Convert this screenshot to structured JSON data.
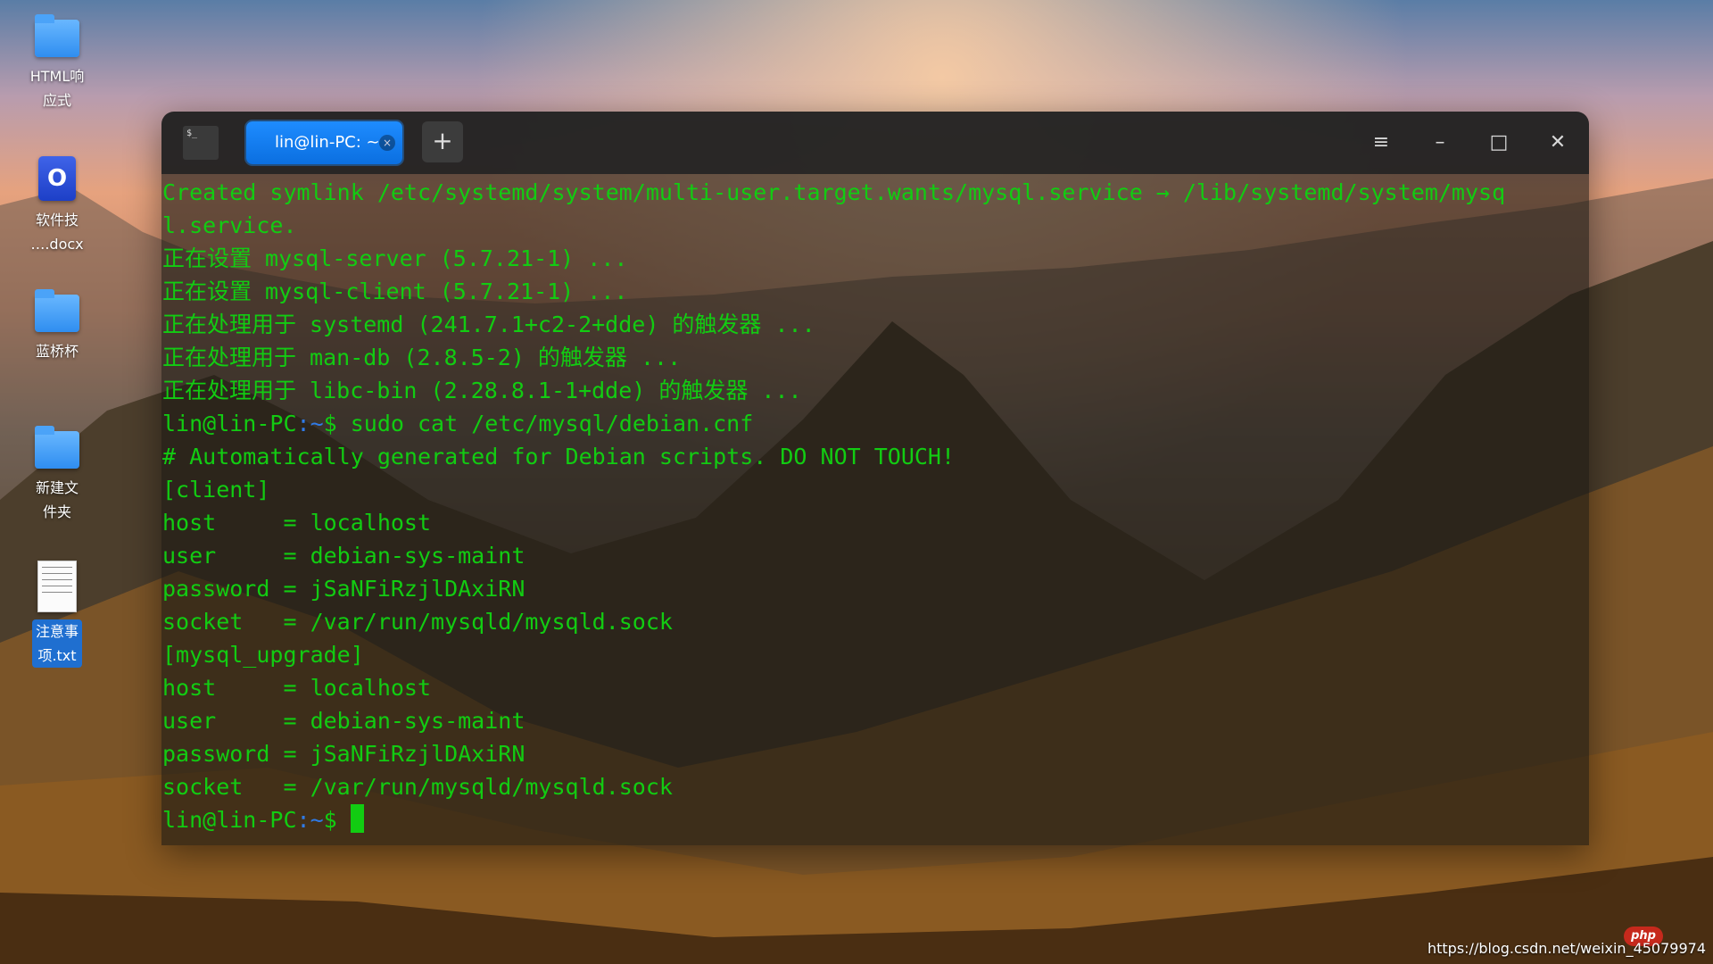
{
  "desktop": {
    "icons": [
      {
        "label": "HTML响\n应式",
        "type": "folder"
      },
      {
        "label": "软件技\n….docx",
        "type": "docx",
        "glyph": "O"
      },
      {
        "label": "蓝桥杯",
        "type": "folder"
      },
      {
        "label": "新建文\n件夹",
        "type": "folder"
      },
      {
        "label": "注意事\n项.txt",
        "type": "txt",
        "selected": true
      }
    ]
  },
  "terminal": {
    "tab_title": "lin@lin-PC: ~",
    "tab_close": "×",
    "add_tab": "+",
    "icon_text": "$_",
    "window_controls": {
      "menu": "≡",
      "minimize": "–",
      "maximize": "□",
      "close": "✕"
    },
    "lines": [
      "Created symlink /etc/systemd/system/multi-user.target.wants/mysql.service → /lib/systemd/system/mysq",
      "l.service.",
      "正在设置 mysql-server (5.7.21-1) ...",
      "正在设置 mysql-client (5.7.21-1) ...",
      "正在处理用于 systemd (241.7.1+c2-2+dde) 的触发器 ...",
      "正在处理用于 man-db (2.8.5-2) 的触发器 ...",
      "正在处理用于 libc-bin (2.28.8.1-1+dde) 的触发器 ..."
    ],
    "prompt_user": "lin@lin-PC",
    "prompt_path": ":~",
    "prompt_symbol": "$",
    "command": " sudo cat /etc/mysql/debian.cnf",
    "output": [
      "# Automatically generated for Debian scripts. DO NOT TOUCH!",
      "[client]",
      "host     = localhost",
      "user     = debian-sys-maint",
      "password = jSaNFiRzjlDAxiRN",
      "socket   = /var/run/mysqld/mysqld.sock",
      "[mysql_upgrade]",
      "host     = localhost",
      "user     = debian-sys-maint",
      "password = jSaNFiRzjlDAxiRN",
      "socket   = /var/run/mysqld/mysqld.sock"
    ]
  },
  "watermark": {
    "logo": "php",
    "url": "https://blog.csdn.net/weixin_45079974"
  },
  "colors": {
    "terminal_text": "#12cc12",
    "path": "#2f7be8",
    "tab_active": "#1e8cff"
  }
}
